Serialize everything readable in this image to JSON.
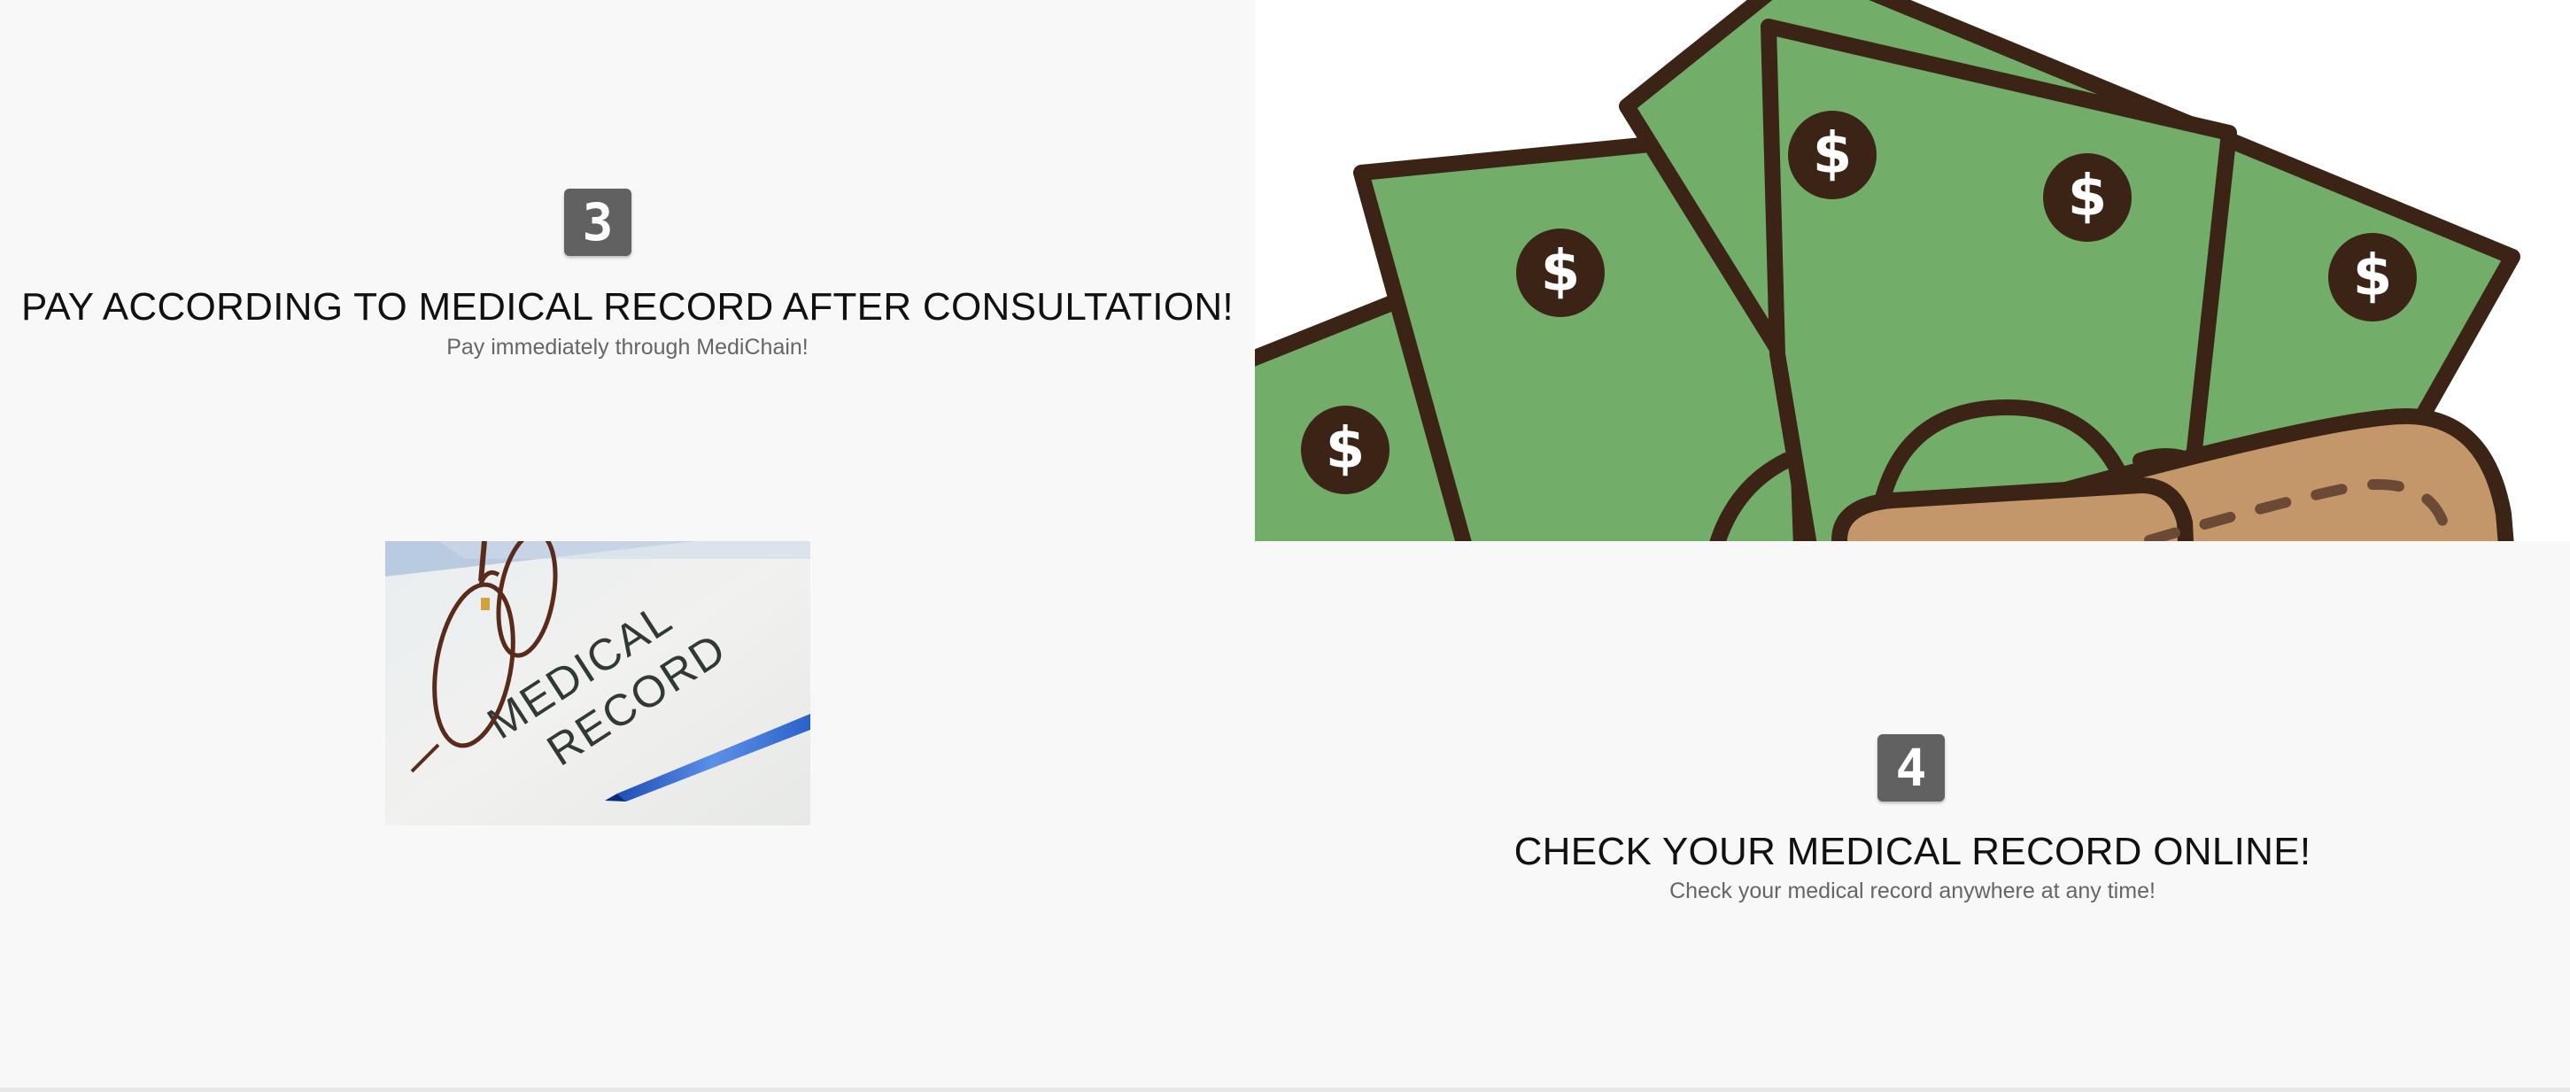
{
  "step3": {
    "number": "3",
    "title": "PAY ACCORDING TO MEDICAL RECORD AFTER CONSULTATION!",
    "subtitle": "Pay immediately through MediChain!"
  },
  "photo": {
    "label_line1": "MEDICAL",
    "label_line2": "RECORD"
  },
  "illustration": {
    "icon": "money-wallet-illustration",
    "symbol": "$"
  },
  "step4": {
    "number": "4",
    "title": "CHECK YOUR MEDICAL RECORD ONLINE!",
    "subtitle": "Check your medical record anywhere at any time!"
  },
  "colors": {
    "badge": "#616161",
    "cash_green": "#72ad6a",
    "outline": "#3b2416",
    "wallet": "#c4976a"
  }
}
